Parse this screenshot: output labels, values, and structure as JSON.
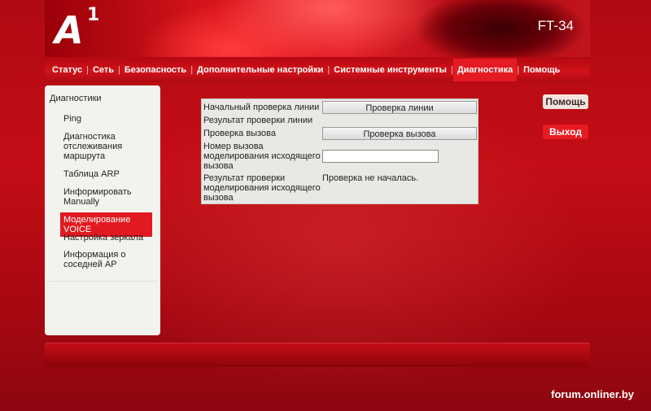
{
  "header": {
    "logo_letter": "A",
    "logo_digit": "1",
    "model": "FT-34"
  },
  "nav": {
    "items": [
      {
        "label": "Статус"
      },
      {
        "label": "Сеть"
      },
      {
        "label": "Безопасность"
      },
      {
        "label": "Дополнительные настройки"
      },
      {
        "label": "Системные инструменты"
      },
      {
        "label": "Диагностика",
        "active": true
      },
      {
        "label": "Помощь"
      }
    ]
  },
  "sidebar": {
    "title": "Диагностики",
    "items": [
      {
        "label": "Ping"
      },
      {
        "label": "Диагностика отслеживания маршрута"
      },
      {
        "label": "Таблица ARP"
      },
      {
        "label": "Информировать Manually"
      },
      {
        "label": "Моделирование VOICE",
        "active": true
      },
      {
        "label": "Настройка зеркала"
      },
      {
        "label": "Информация о соседней AP"
      }
    ]
  },
  "form": {
    "line_check_label": "Начальный проверка линии",
    "line_check_button": "Проверка линии",
    "line_result_label": "Результат проверки линии",
    "call_check_label": "Проверка вызова",
    "call_check_button": "Проверка вызова",
    "number_label": "Номер вызова моделирования исходящего вызова",
    "number_value": "",
    "sim_result_label": "Результат проверки моделирования исходящего вызова",
    "sim_result_value": "Проверка не началась."
  },
  "actions": {
    "help": "Помощь",
    "exit": "Выход"
  },
  "watermark": "forum.onliner.by",
  "colors": {
    "brand_red": "#e01a20",
    "panel_bg": "#e8e8e4",
    "sidebar_bg": "#f3f3ee"
  }
}
